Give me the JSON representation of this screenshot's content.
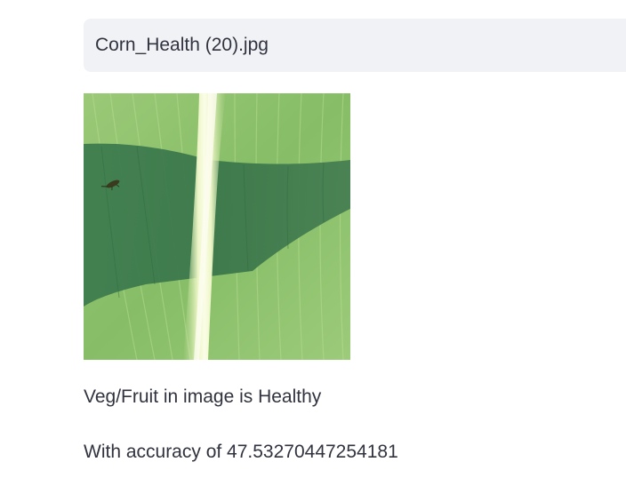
{
  "selectbox": {
    "value": "Corn_Health (20).jpg"
  },
  "uploaded_image": {
    "icon": "leaf-photo",
    "colors": {
      "leaf_light": "#8cc26a",
      "leaf_shadow": "#3e7c4e",
      "midrib": "#f3f7d6"
    }
  },
  "result": {
    "prediction_text": "Veg/Fruit in image is Healthy",
    "accuracy_text": "With accuracy of 47.53270447254181"
  }
}
